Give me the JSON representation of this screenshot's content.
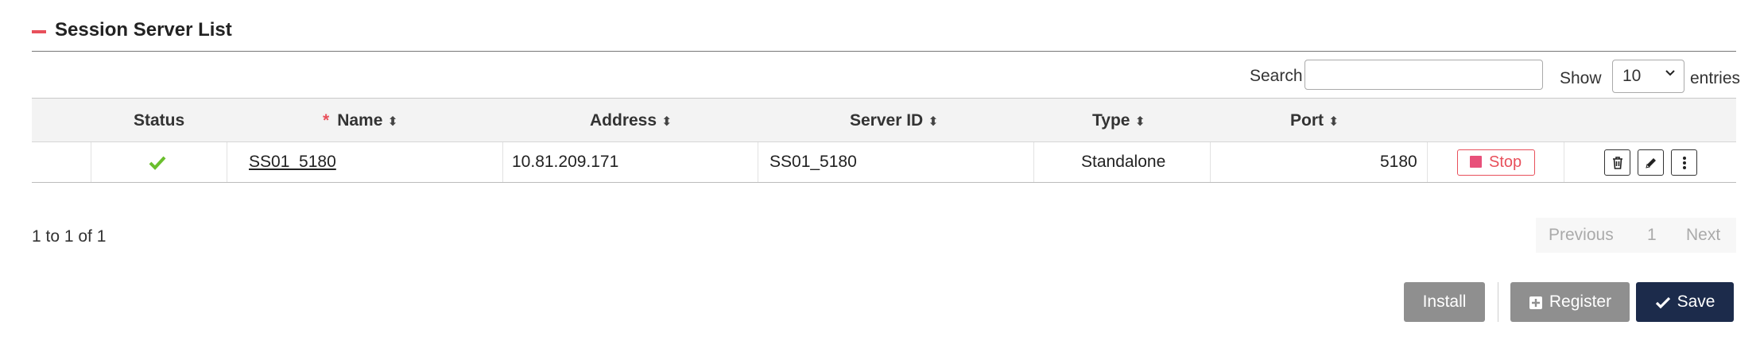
{
  "section": {
    "title": "Session Server List"
  },
  "controls": {
    "search_label": "Search",
    "search_value": "",
    "show_label": "Show",
    "entries_value": "10",
    "entries_label": "entries"
  },
  "table": {
    "columns": [
      {
        "label": "Status",
        "required": false,
        "sortable": false
      },
      {
        "label": "Name",
        "required": true,
        "sortable": true
      },
      {
        "label": "Address",
        "required": false,
        "sortable": true
      },
      {
        "label": "Server ID",
        "required": false,
        "sortable": true
      },
      {
        "label": "Type",
        "required": false,
        "sortable": true
      },
      {
        "label": "Port",
        "required": false,
        "sortable": true
      }
    ],
    "required_mark": "*",
    "sort_glyph": "⬍",
    "rows": [
      {
        "status_icon": "check-icon",
        "name": "SS01_5180",
        "address": "10.81.209.171",
        "server_id": "SS01_5180",
        "type": "Standalone",
        "port": "5180",
        "stop_label": "Stop"
      }
    ]
  },
  "pagination": {
    "info": "1 to 1 of 1",
    "previous": "Previous",
    "current_page": "1",
    "next": "Next"
  },
  "footer": {
    "install_label": "Install",
    "register_label": "Register",
    "save_label": "Save"
  },
  "colors": {
    "accent_red": "#e8505b",
    "check_green": "#6abf2d",
    "save_navy": "#1c2b4b",
    "gray_button": "#8f8f8f"
  }
}
